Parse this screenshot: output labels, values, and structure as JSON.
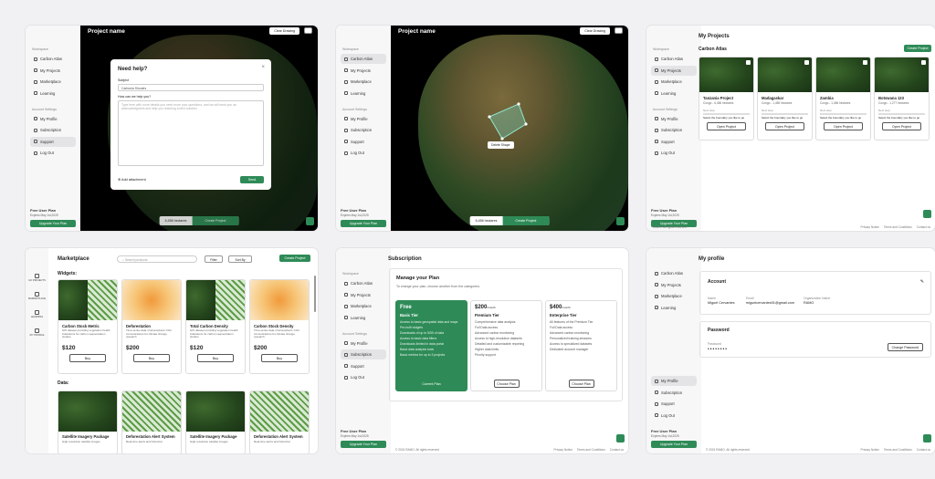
{
  "nav": {
    "workspace": "Workspace",
    "account": "Account Settings",
    "carbon_atlas": "Carbon Atlas",
    "my_projects": "My Projects",
    "marketplace": "Marketplace",
    "learning": "Learning",
    "my_profile": "My Profile",
    "subscription": "Subscription",
    "support": "Support",
    "log_out": "Log Out"
  },
  "plan": {
    "title": "Free User Plan",
    "expires": "Expires May 1st,2025",
    "upgrade": "Upgrade Your Plan"
  },
  "map": {
    "project_title": "Project name",
    "clear_drawing": "Clear Drawing",
    "hectares": "6,456 hectares",
    "create_project": "Create Project",
    "delete_shape": "Delete Shape"
  },
  "help_modal": {
    "title": "Need help?",
    "subject_label": "Subject",
    "subject_value": "Carbonia Shoutes",
    "message_label": "How can we help you?",
    "message_placeholder": "Type here with more details you need more your questions, and we will send you an acknowledgment and help you reaching a best solution.",
    "attachment": "Add attachment",
    "send": "Send"
  },
  "projects": {
    "title": "My Projects",
    "section": "Carbon Atlas",
    "create": "Create Project",
    "open": "Open Project",
    "next_step": "Next step",
    "next_step_text": "Select the boundary you like to go",
    "items": [
      {
        "name": "Tanzania Project",
        "meta": "Congo - 6,456 hectares"
      },
      {
        "name": "Madagaskar",
        "meta": "Congo - 1,456 hectares"
      },
      {
        "name": "Zambia",
        "meta": "Congo - 1,456 hectares"
      },
      {
        "name": "Botswana 123",
        "meta": "Congo - 1,277 hectares"
      }
    ]
  },
  "footer": {
    "copyright": "© 2024 RAMO. All rights reserved",
    "privacy": "Privacy Notice",
    "terms": "Terms and Conditions",
    "contact": "Contact us",
    "short": "RAMO. All rights reserved"
  },
  "market": {
    "title": "Marketplace",
    "search": "Search products",
    "filter": "Filter",
    "sort": "Sort By",
    "create": "Create Project",
    "widgets": "Widgets:",
    "data": "Data:",
    "buy": "Buy",
    "rail": [
      "GO PROJECTS",
      "MARKETPLACE",
      "LEARNING",
      "MY PROFILE"
    ],
    "widget_items": [
      {
        "name": "Carbon Stock Metric",
        "desc": "GIS dataset providing vegetation health indications for carbon sequestration studies",
        "price": "$120"
      },
      {
        "name": "Deforestation",
        "desc": "Time-series data of atmospheric CO2 concentrations for climate change research",
        "price": "$200"
      },
      {
        "name": "Total Carbon Density",
        "desc": "GIS dataset providing vegetation health indications for carbon sequestration studies",
        "price": "$120"
      },
      {
        "name": "Carbon Stock Density",
        "desc": "Time-series data of atmospheric CO2 concentrations for climate change research",
        "price": "$200"
      }
    ],
    "data_items": [
      {
        "name": "Satellite Imagery Package",
        "desc": "High-resolution satellite images"
      },
      {
        "name": "Deforestation Alert System",
        "desc": "Real-time alerts and historical"
      },
      {
        "name": "Satellite Imagery Package",
        "desc": "High-resolution satellite images"
      },
      {
        "name": "Deforestation Alert System",
        "desc": "Real-time alerts and historical"
      }
    ]
  },
  "sub": {
    "title": "Subscription",
    "heading": "Manage your Plan",
    "intro": "To change your plan, choose another from the categories.",
    "tiers": [
      {
        "price": "Free",
        "name": "Basic Tier",
        "button": "Current Plan",
        "features": [
          "Access to basic geospatial data and maps",
          "Pre-built widgets",
          "Downloads of up to 5GB of data",
          "Access to basic data filters",
          "Downloads limited in data portal",
          "Basic data analysis tools",
          "Basic metrics for up to 3 projects"
        ]
      },
      {
        "price": "$200",
        "unit": "/month",
        "name": "Premium Tier",
        "button": "Choose Plan",
        "features": [
          "Comprehensive data analysis",
          "Full Data access",
          "Advanced carbon monitoring",
          "Access to high-resolution datasets",
          "Detailed and customizable reporting",
          "Higher data limits",
          "Priority support"
        ]
      },
      {
        "price": "$400",
        "unit": "/month",
        "name": "Enterprise Tier",
        "button": "Choose Plan",
        "features": [
          "All features of the Premium Tier",
          "Full Data access",
          "Advanced carbon monitoring",
          "Personalized training sessions",
          "Access to specialized datasets",
          "Dedicated account manager"
        ]
      }
    ]
  },
  "profile": {
    "title": "My profile",
    "account": "Account",
    "name_label": "Name",
    "name_value": "Miguel Cervantes",
    "email_label": "Email",
    "email_value": "miguelcervantes91@gmail.com",
    "org_label": "Organization Name",
    "org_value": "RAMO",
    "password": "Password",
    "password_label": "Password",
    "password_value": "••••••••",
    "change": "Change Password"
  }
}
